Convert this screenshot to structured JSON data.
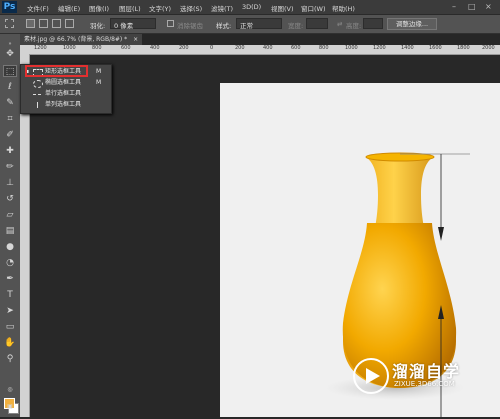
{
  "app": {
    "logo": "Ps"
  },
  "menu": [
    "文件(F)",
    "编辑(E)",
    "图像(I)",
    "图层(L)",
    "文字(Y)",
    "选择(S)",
    "滤镜(T)",
    "3D(D)",
    "视图(V)",
    "窗口(W)",
    "帮助(H)"
  ],
  "window_controls": [
    "–",
    "□",
    "×"
  ],
  "options": {
    "feather_label": "羽化:",
    "feather_value": "0 像素",
    "antialias_label": "消除锯齿",
    "style_label": "样式:",
    "style_value": "正常",
    "width_label": "宽度:",
    "height_label": "高度:",
    "refine_button": "调整边缘..."
  },
  "document_tab": {
    "title": "素材.jpg @ 66.7% (背景, RGB/8#) *",
    "close": "×"
  },
  "ruler_ticks": [
    "1200",
    "1000",
    "800",
    "600",
    "400",
    "200",
    "0",
    "200",
    "400",
    "600",
    "800",
    "1000",
    "1200",
    "1400",
    "1600",
    "1800",
    "2000"
  ],
  "flyout": [
    {
      "label": "矩形选框工具",
      "key": "M",
      "icon": "rect-marquee-icon"
    },
    {
      "label": "椭圆选框工具",
      "key": "M",
      "icon": "ellipse-marquee-icon"
    },
    {
      "label": "单行选框工具",
      "key": "",
      "icon": "single-row-marquee-icon"
    },
    {
      "label": "单列选框工具",
      "key": "",
      "icon": "single-column-marquee-icon"
    }
  ],
  "watermark": {
    "title": "溜溜自学",
    "subtitle": "ZIXUE.3D66.COM"
  },
  "colors": {
    "foreground": "#f0b040",
    "background": "#ffffff",
    "vase": "#f2a900",
    "highlight": "#e23030"
  }
}
